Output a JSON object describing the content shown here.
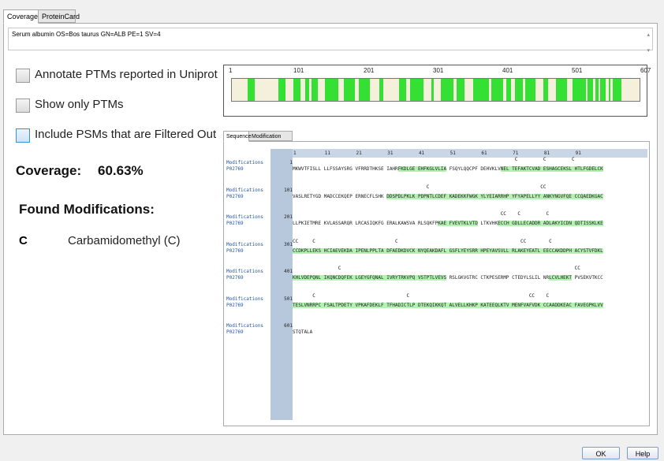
{
  "tabs": [
    {
      "label": "Coverage"
    },
    {
      "label": "ProteinCard"
    }
  ],
  "description": "Serum albumin OS=Bos taurus GN=ALB PE=1 SV=4",
  "options": {
    "annotate": "Annotate PTMs reported in Uniprot",
    "show_only": "Show only PTMs",
    "include_psms": "Include PSMs that are Filtered Out"
  },
  "coverage": {
    "label": "Coverage:",
    "value": "60.63%"
  },
  "found_mods": {
    "title": "Found Modifications:",
    "items": [
      {
        "symbol": "C",
        "name": "Carbamidomethyl (C)"
      }
    ]
  },
  "map": {
    "ticks": [
      "1",
      "101",
      "201",
      "301",
      "401",
      "501",
      "607"
    ],
    "length": 607,
    "covered": [
      [
        25,
        34
      ],
      [
        70,
        80
      ],
      [
        93,
        102
      ],
      [
        110,
        115
      ],
      [
        120,
        128
      ],
      [
        139,
        159
      ],
      [
        168,
        183
      ],
      [
        190,
        205
      ],
      [
        221,
        226
      ],
      [
        250,
        259
      ],
      [
        266,
        285
      ],
      [
        298,
        301
      ],
      [
        312,
        330
      ],
      [
        336,
        346
      ],
      [
        360,
        383
      ],
      [
        387,
        404
      ],
      [
        410,
        416
      ],
      [
        422,
        433
      ],
      [
        438,
        452
      ],
      [
        465,
        471
      ],
      [
        483,
        499
      ],
      [
        508,
        527
      ],
      [
        530,
        538
      ],
      [
        542,
        546
      ],
      [
        549,
        557
      ],
      [
        562,
        564
      ],
      [
        568,
        580
      ]
    ]
  },
  "seq_tabs": [
    {
      "label": "Sequence"
    },
    {
      "label": "Modification List"
    }
  ],
  "seq_header": "1          11         21         31         41         51         61         71         81         91",
  "rows": [
    {
      "label1": "Modifications",
      "label2": "P02769",
      "num": "1",
      "mods": "                                                                              C         C         C",
      "parts": [
        [
          "MKWVTFISLL LLFSSAYSRG VFRRDTHKSE IAHR",
          0
        ],
        [
          "FKDLGE EHFKGLVLIA",
          1
        ],
        [
          " FSQYLQQCPF DEHVKLV",
          0
        ],
        [
          "NEL TEFAKTCVAD ESHAGCEKSL HTLFGDELCK",
          1
        ]
      ]
    },
    {
      "label1": "Modifications",
      "label2": "P02769",
      "num": "101",
      "mods": "                                               C                                       CC",
      "parts": [
        [
          "VASLRETYGD MADCCEKQEP ERNECFLSHK ",
          0
        ],
        [
          "DDSPDLPKLK PDPNTLCDEF KADEKKFWGK YLYEIARRHP YFYAPELLYY ANKYNGVFQE CCQAEDKGAC",
          1
        ]
      ]
    },
    {
      "label1": "Modifications",
      "label2": "P02769",
      "num": "201",
      "mods": "                                                                         CC    C         C",
      "parts": [
        [
          "LLPKIETMRE KVLASSARQR LRCASIQKFG ERALKAWSVA RLSQKFP",
          0
        ],
        [
          "KAE FVEVTKLVTD",
          1
        ],
        [
          " LTKVHK",
          0
        ],
        [
          "ECCH GDLLECADDR ADLAKYICDN QDTISSKLKE",
          1
        ]
      ]
    },
    {
      "label1": "Modifications",
      "label2": "P02769",
      "num": "301",
      "mods": "CC     C                            C                                           CC        C",
      "parts": [
        [
          "CCDKPLLEKS HCIAEVEKDA IPENLPPLTA DFAEDKDVCK NYQEAKDAFL GSFLYEYSRR HPEYAVSVLL RLAKEYEATL EECCAKDDPH ACYSTVFDKL",
          1
        ]
      ]
    },
    {
      "label1": "Modifications",
      "label2": "P02769",
      "num": "401",
      "mods": "                C                                                                                  CC",
      "parts": [
        [
          "KHLVDEPQNL IKQNCDQFEK LGEYGFQNAL IVRYTRKVPQ VSTPTLVEVS",
          1
        ],
        [
          " RSLGKVGTRC CTKPESERMP CTEDYLSLIL NR",
          0
        ],
        [
          "LCVLHEKT",
          1
        ],
        [
          " PVSEKVTKCC",
          0
        ]
      ]
    },
    {
      "label1": "Modifications",
      "label2": "P02769",
      "num": "501",
      "mods": "       C                                C                                          CC    C",
      "parts": [
        [
          "TESLVNRRPC FSALTPDETY VPKAFDEKLF TFHADICTLP DTEKQIKKQT ALVELLKHKP KATEEQLKTV MENFVAFVDK CCAADDKEAC FAVEGPKLVV",
          1
        ]
      ]
    },
    {
      "label1": "Modifications",
      "label2": "P02769",
      "num": "601",
      "mods": "",
      "parts": [
        [
          "STQTALA",
          0
        ]
      ]
    }
  ],
  "buttons": {
    "ok": "OK",
    "help": "Help"
  }
}
